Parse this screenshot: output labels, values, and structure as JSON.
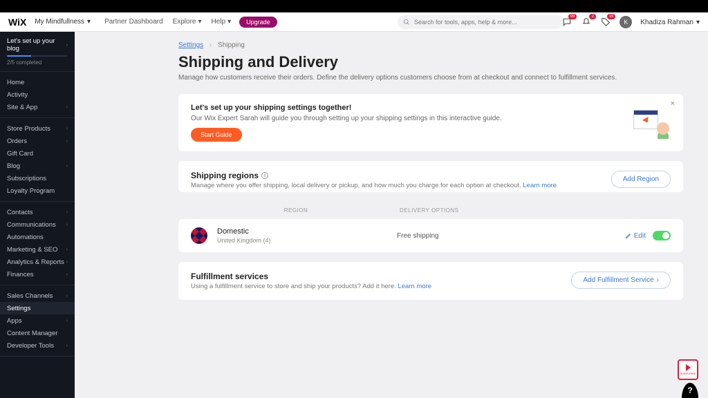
{
  "topbar": {
    "logo": "WiX",
    "site_name": "My Mindfullness",
    "nav": [
      "Partner Dashboard",
      "Explore",
      "Help"
    ],
    "upgrade": "Upgrade",
    "search_placeholder": "Search for tools, apps, help & more...",
    "badges": [
      "99",
      "2",
      "19"
    ],
    "avatar_initial": "K",
    "username": "Khadiza Rahman"
  },
  "sidebar": {
    "setup_label": "Let's set up your blog",
    "progress_label": "2/5 completed",
    "sections": [
      {
        "items": [
          {
            "l": "Home"
          },
          {
            "l": "Activity"
          },
          {
            "l": "Site & App",
            "c": true
          }
        ]
      },
      {
        "items": [
          {
            "l": "Store Products",
            "c": true
          },
          {
            "l": "Orders",
            "c": true
          },
          {
            "l": "Gift Card"
          },
          {
            "l": "Blog",
            "c": true
          },
          {
            "l": "Subscriptions"
          },
          {
            "l": "Loyalty Program"
          }
        ]
      },
      {
        "items": [
          {
            "l": "Contacts",
            "c": true
          },
          {
            "l": "Communications",
            "c": true
          },
          {
            "l": "Automations"
          },
          {
            "l": "Marketing & SEO",
            "c": true
          },
          {
            "l": "Analytics & Reports",
            "c": true
          },
          {
            "l": "Finances",
            "c": true
          }
        ]
      },
      {
        "items": [
          {
            "l": "Sales Channels",
            "c": true
          },
          {
            "l": "Settings",
            "active": true
          },
          {
            "l": "Apps",
            "c": true
          },
          {
            "l": "Content Manager"
          },
          {
            "l": "Developer Tools",
            "c": true
          }
        ]
      }
    ]
  },
  "breadcrumb": {
    "root": "Settings",
    "current": "Shipping"
  },
  "page": {
    "title": "Shipping and Delivery",
    "subtitle": "Manage how customers receive their orders. Define the delivery options customers choose from at checkout and connect to fulfillment services."
  },
  "guide": {
    "title": "Let's set up your shipping settings together!",
    "desc": "Our Wix Expert Sarah will guide you through setting up your shipping settings in this interactive guide.",
    "button": "Start Guide"
  },
  "regions": {
    "title": "Shipping regions",
    "desc": "Manage where you offer shipping, local delivery or pickup, and how much you charge for each option at checkout. ",
    "learn_more": "Learn more",
    "add_button": "Add Region",
    "col_region": "REGION",
    "col_delivery": "DELIVERY OPTIONS",
    "row": {
      "name": "Domestic",
      "sub": "United Kingdom (4)",
      "delivery": "Free shipping",
      "edit": "Edit"
    }
  },
  "fulfillment": {
    "title": "Fulfillment services",
    "desc": "Using a fulfillment service to store and ship your products? Add it here. ",
    "learn_more": "Learn more",
    "add_button": "Add Fulfillment Service"
  },
  "floating": {
    "subscribe": "SUBSCRIBE",
    "help": "?"
  }
}
